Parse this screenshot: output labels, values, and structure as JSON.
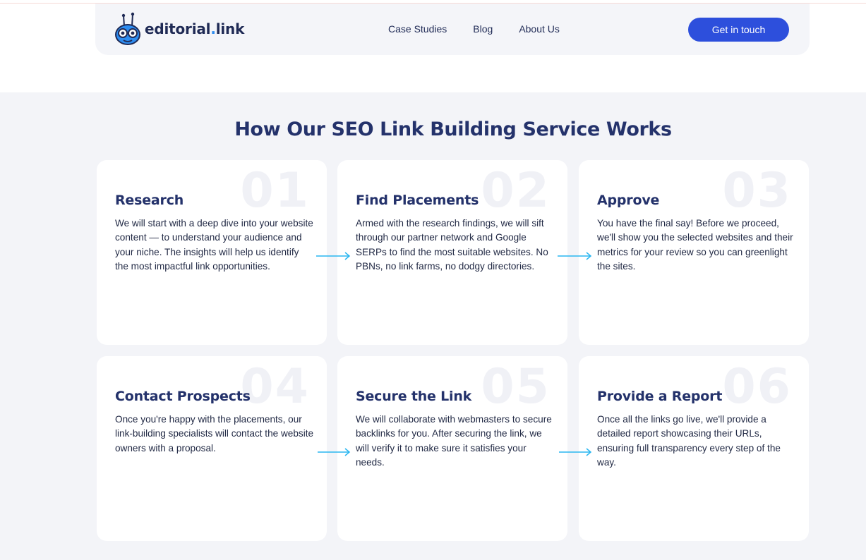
{
  "header": {
    "logo_text_main": "editorial",
    "logo_text_dot": ".",
    "logo_text_end": "link",
    "nav": [
      "Case Studies",
      "Blog",
      "About Us"
    ],
    "cta_label": "Get in touch"
  },
  "section": {
    "title": "How Our SEO Link Building Service Works",
    "steps": [
      {
        "num": "01",
        "title": "Research",
        "text": "We will start with a deep dive into your website content — to understand your audience and your niche. The insights will help us identify the most impactful link opportunities."
      },
      {
        "num": "02",
        "title": "Find Placements",
        "text": "Armed with the research findings, we will sift through our partner network and Google SERPs to find the most suitable websites. No PBNs, no link farms, no dodgy directories."
      },
      {
        "num": "03",
        "title": "Approve",
        "text": "You have the final say! Before we proceed, we'll show you the selected websites and their metrics for your review so you can greenlight the sites."
      },
      {
        "num": "04",
        "title": "Contact Prospects",
        "text": "Once you're happy with the placements, our link-building specialists will contact the website owners with a proposal."
      },
      {
        "num": "05",
        "title": "Secure the Link",
        "text": "We will collaborate with webmasters to secure backlinks for you. After securing the link, we will verify it to make sure it satisfies your needs."
      },
      {
        "num": "06",
        "title": "Provide a Report",
        "text": "Once all the links go live, we'll provide a detailed report showcasing their URLs, ensuring full transparency every step of the way."
      }
    ]
  },
  "colors": {
    "accent": "#2d4fdc",
    "heading": "#24326b",
    "arrow": "#29b6f0"
  },
  "icons": [
    "robot-logo-icon",
    "arrow-right-icon"
  ]
}
